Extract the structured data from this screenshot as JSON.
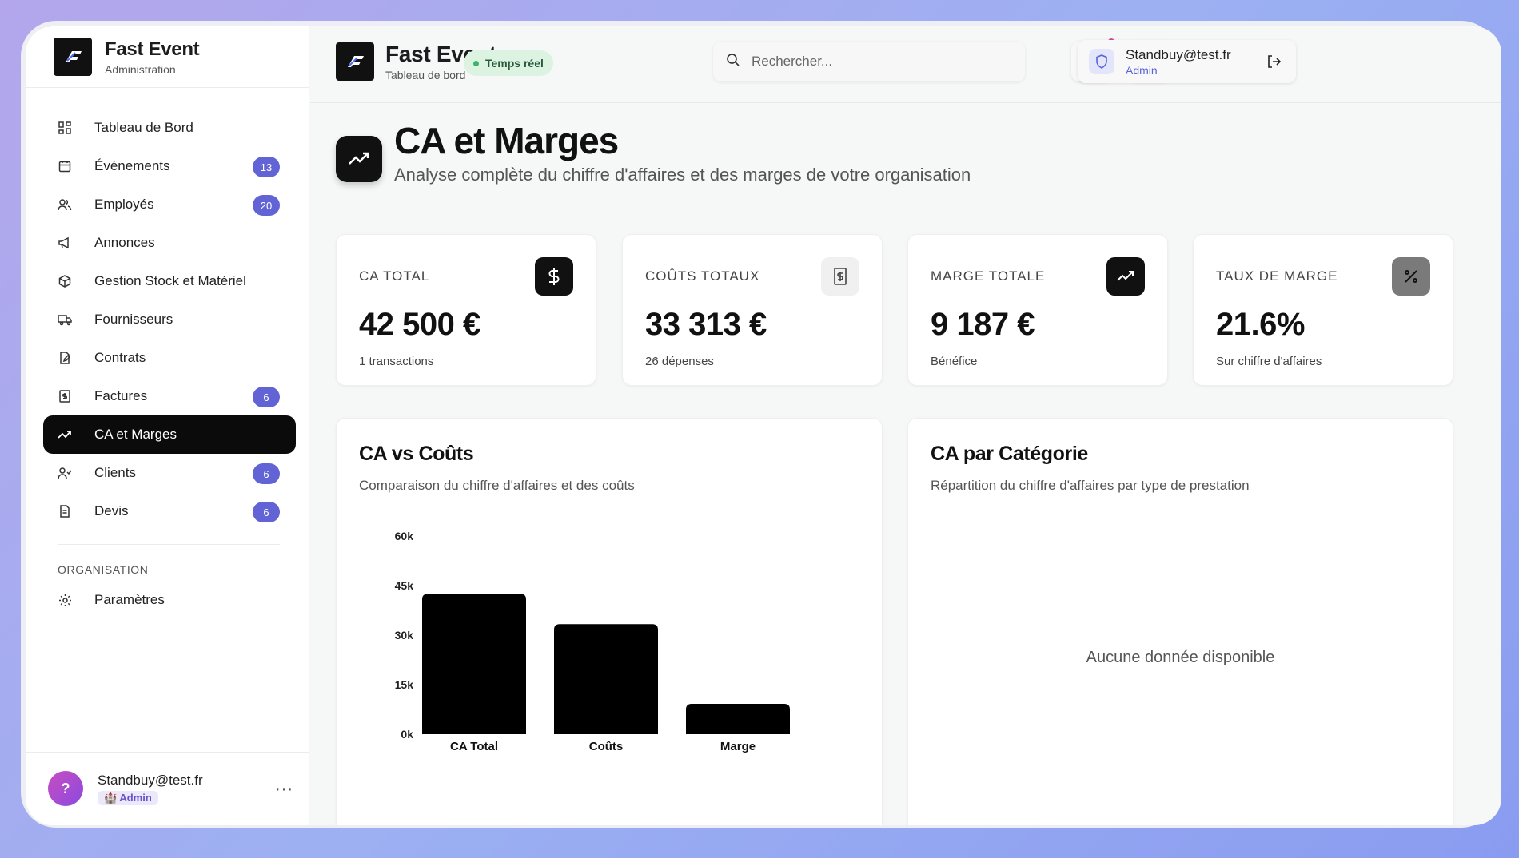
{
  "sidebar": {
    "brand_title": "Fast Event",
    "brand_sub": "Administration",
    "items": [
      {
        "label": "Tableau de Bord",
        "icon": "dashboard-grid-icon",
        "badge": null
      },
      {
        "label": "Événements",
        "icon": "calendar-icon",
        "badge": "13"
      },
      {
        "label": "Employés",
        "icon": "users-icon",
        "badge": "20"
      },
      {
        "label": "Annonces",
        "icon": "megaphone-icon",
        "badge": null
      },
      {
        "label": "Gestion Stock et Matériel",
        "icon": "package-icon",
        "badge": null
      },
      {
        "label": "Fournisseurs",
        "icon": "truck-icon",
        "badge": null
      },
      {
        "label": "Contrats",
        "icon": "file-edit-icon",
        "badge": null
      },
      {
        "label": "Factures",
        "icon": "receipt-icon",
        "badge": "6"
      },
      {
        "label": "CA et Marges",
        "icon": "trending-up-icon",
        "badge": null,
        "active": true
      },
      {
        "label": "Clients",
        "icon": "user-check-icon",
        "badge": "6"
      },
      {
        "label": "Devis",
        "icon": "file-text-icon",
        "badge": "6"
      }
    ],
    "section_label": "ORGANISATION",
    "settings_label": "Paramètres",
    "user": {
      "avatar": "?",
      "name": "Standbuy@test.fr",
      "role": "🏰 Admin"
    }
  },
  "header": {
    "title": "Fast Event",
    "subtitle": "Tableau de bord",
    "live_label": "Temps réel",
    "search_placeholder": "Rechercher...",
    "user_name": "Standbuy@test.fr",
    "user_role": "Admin"
  },
  "page": {
    "title": "CA et Marges",
    "subtitle": "Analyse complète du chiffre d'affaires et des marges de votre organisation"
  },
  "stats": [
    {
      "label": "CA TOTAL",
      "value": "42 500 €",
      "note": "1 transactions",
      "icon": "dollar-icon",
      "icon_bg": "#111111"
    },
    {
      "label": "COÛTS TOTAUX",
      "value": "33 313 €",
      "note": "26 dépenses",
      "icon": "receipt-dollar-icon",
      "icon_bg": "#f0f0f0"
    },
    {
      "label": "MARGE TOTALE",
      "value": "9 187 €",
      "note": "Bénéfice",
      "icon": "trending-up-icon",
      "icon_bg": "#111111"
    },
    {
      "label": "TAUX DE MARGE",
      "value": "21.6%",
      "note": "Sur chiffre d'affaires",
      "icon": "percent-icon",
      "icon_bg": "#7a7a7a"
    }
  ],
  "charts": {
    "costs": {
      "title": "CA vs Coûts",
      "subtitle": "Comparaison du chiffre d'affaires et des coûts"
    },
    "category": {
      "title": "CA par Catégorie",
      "subtitle": "Répartition du chiffre d'affaires par type de prestation",
      "empty": "Aucune donnée disponible"
    }
  },
  "chart_data": {
    "type": "bar",
    "categories": [
      "CA Total",
      "Coûts",
      "Marge"
    ],
    "values": [
      42500,
      33313,
      9187
    ],
    "yticks": [
      "60k",
      "45k",
      "30k",
      "15k",
      "0k"
    ],
    "ylim": [
      0,
      60000
    ],
    "bar_color": "#000000",
    "grid": false
  }
}
